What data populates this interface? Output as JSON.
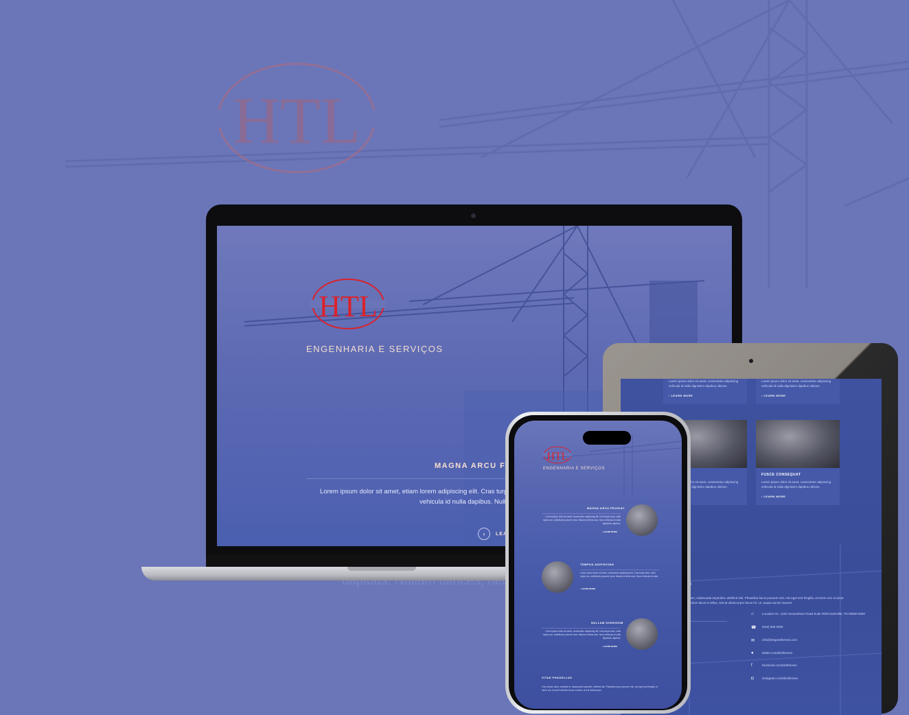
{
  "brand": {
    "logo_text": "HTL",
    "accent": "#d9232d",
    "background": "#6b76b8"
  },
  "laptop": {
    "subtitle": "ENGENHARIA E SERVIÇOS",
    "heading": "MAGNA ARCU FE",
    "paragraph": "Lorem ipsum dolor sit amet, etiam lorem adipiscing elit. Cras turpis ante, nulla turpis non, sollicitudin posuere urna. Mauris id tellus arcu. Nunc vehicula id nulla dapibus. Nullam ultrices, neque et faucibus viverra, ex n",
    "cta": "LEA"
  },
  "background_text": "dapibus. Nullam ultrices, nequ",
  "tablet": {
    "top_cards": [
      {
        "text": "Lorem ipsum dolor sit amet, consectetur adipiscing vehicula id nulla dignissim dapibus ultrices.",
        "more": "LEARN MORE"
      },
      {
        "text": "Lorem ipsum dolor sit amet, consectetur adipiscing vehicula id nulla dignissim dapibus ultrices.",
        "more": "LEARN MORE"
      }
    ],
    "cards": [
      {
        "title": "TUM",
        "text": "Lorem ipsum dolor sit amet, consectetur adipiscing vehicula id nulla dignissim dapibus ultrices.",
        "more": "ORE"
      },
      {
        "title": "FUSCE CONSEQUAT",
        "text": "Lorem ipsum dolor sit amet, consectetur adipiscing vehicula id nulla dignissim dapibus ultrices.",
        "more": "LEARN MORE"
      }
    ],
    "section_heading": "CH",
    "section_text": "Lorem, malesuada imperdiet, eleifend nisl. Phasellus lacus posuere nisl, nisi eget sed fringilla, et lorem orci ut amet interdum lacus in tellus, sed at ullamcorper lacus mi. Ut, auque auctor laoreet.",
    "contacts": [
      {
        "icon": "location-icon",
        "text": "Location Inc. 1234 Somewhere Road Suite #008 Nashville, TN 00000-0000"
      },
      {
        "icon": "phone-icon",
        "text": "(615) 555 0000"
      },
      {
        "icon": "email-icon",
        "text": "info@elegantthemes.com"
      },
      {
        "icon": "twitter-icon",
        "text": "twitter.com/divithemes"
      },
      {
        "icon": "facebook-icon",
        "text": "facebook.com/divithemes"
      },
      {
        "icon": "instagram-icon",
        "text": "instagram.com/divithemes"
      }
    ]
  },
  "phone": {
    "subtitle": "ENGENHARIA E SERVIÇOS",
    "sections": [
      {
        "title": "MAGNA ARCU FEUGIAT",
        "text": "Lorem ipsum dolor sit amet, consectetur adipiscing elit. Cras turpis ante, nulla turpis non, sollicitudin posuere urna. Mauris id tellus arcu. Nunc vehicula id nulla dignissim dapibus.",
        "more": "LEARN MORE"
      },
      {
        "title": "TEMPUS ADIPISCING",
        "text": "Lorem ipsum dolor sit amet, consectetur adipiscing elit. Cras turpis ante, nulla turpis non, sollicitudin posuere urna. Mauris id tellus arcu. Nunc vehicula id nulla.",
        "more": "LEARN MORE"
      },
      {
        "title": "NULLAM DIGNISSIM",
        "text": "Lorem ipsum dolor sit amet, consectetur adipiscing elit. Cras turpis ante, nulla turpis non, sollicitudin posuere urna. Mauris id tellus arcu. Nunc vehicula id nulla dignissim dapibus.",
        "more": "LEARN MORE"
      }
    ],
    "footer_title": "VITAE PHASELLUS",
    "footer_text": "Cras dictum dolor, molestie et, malesuada imperdiet, eleifend nisl. Phasellus lacus posuere nisl, nisi eget sed fringilla, et lorem orci ut amet interdum lacus in tellus, sed at ullamcorper."
  }
}
